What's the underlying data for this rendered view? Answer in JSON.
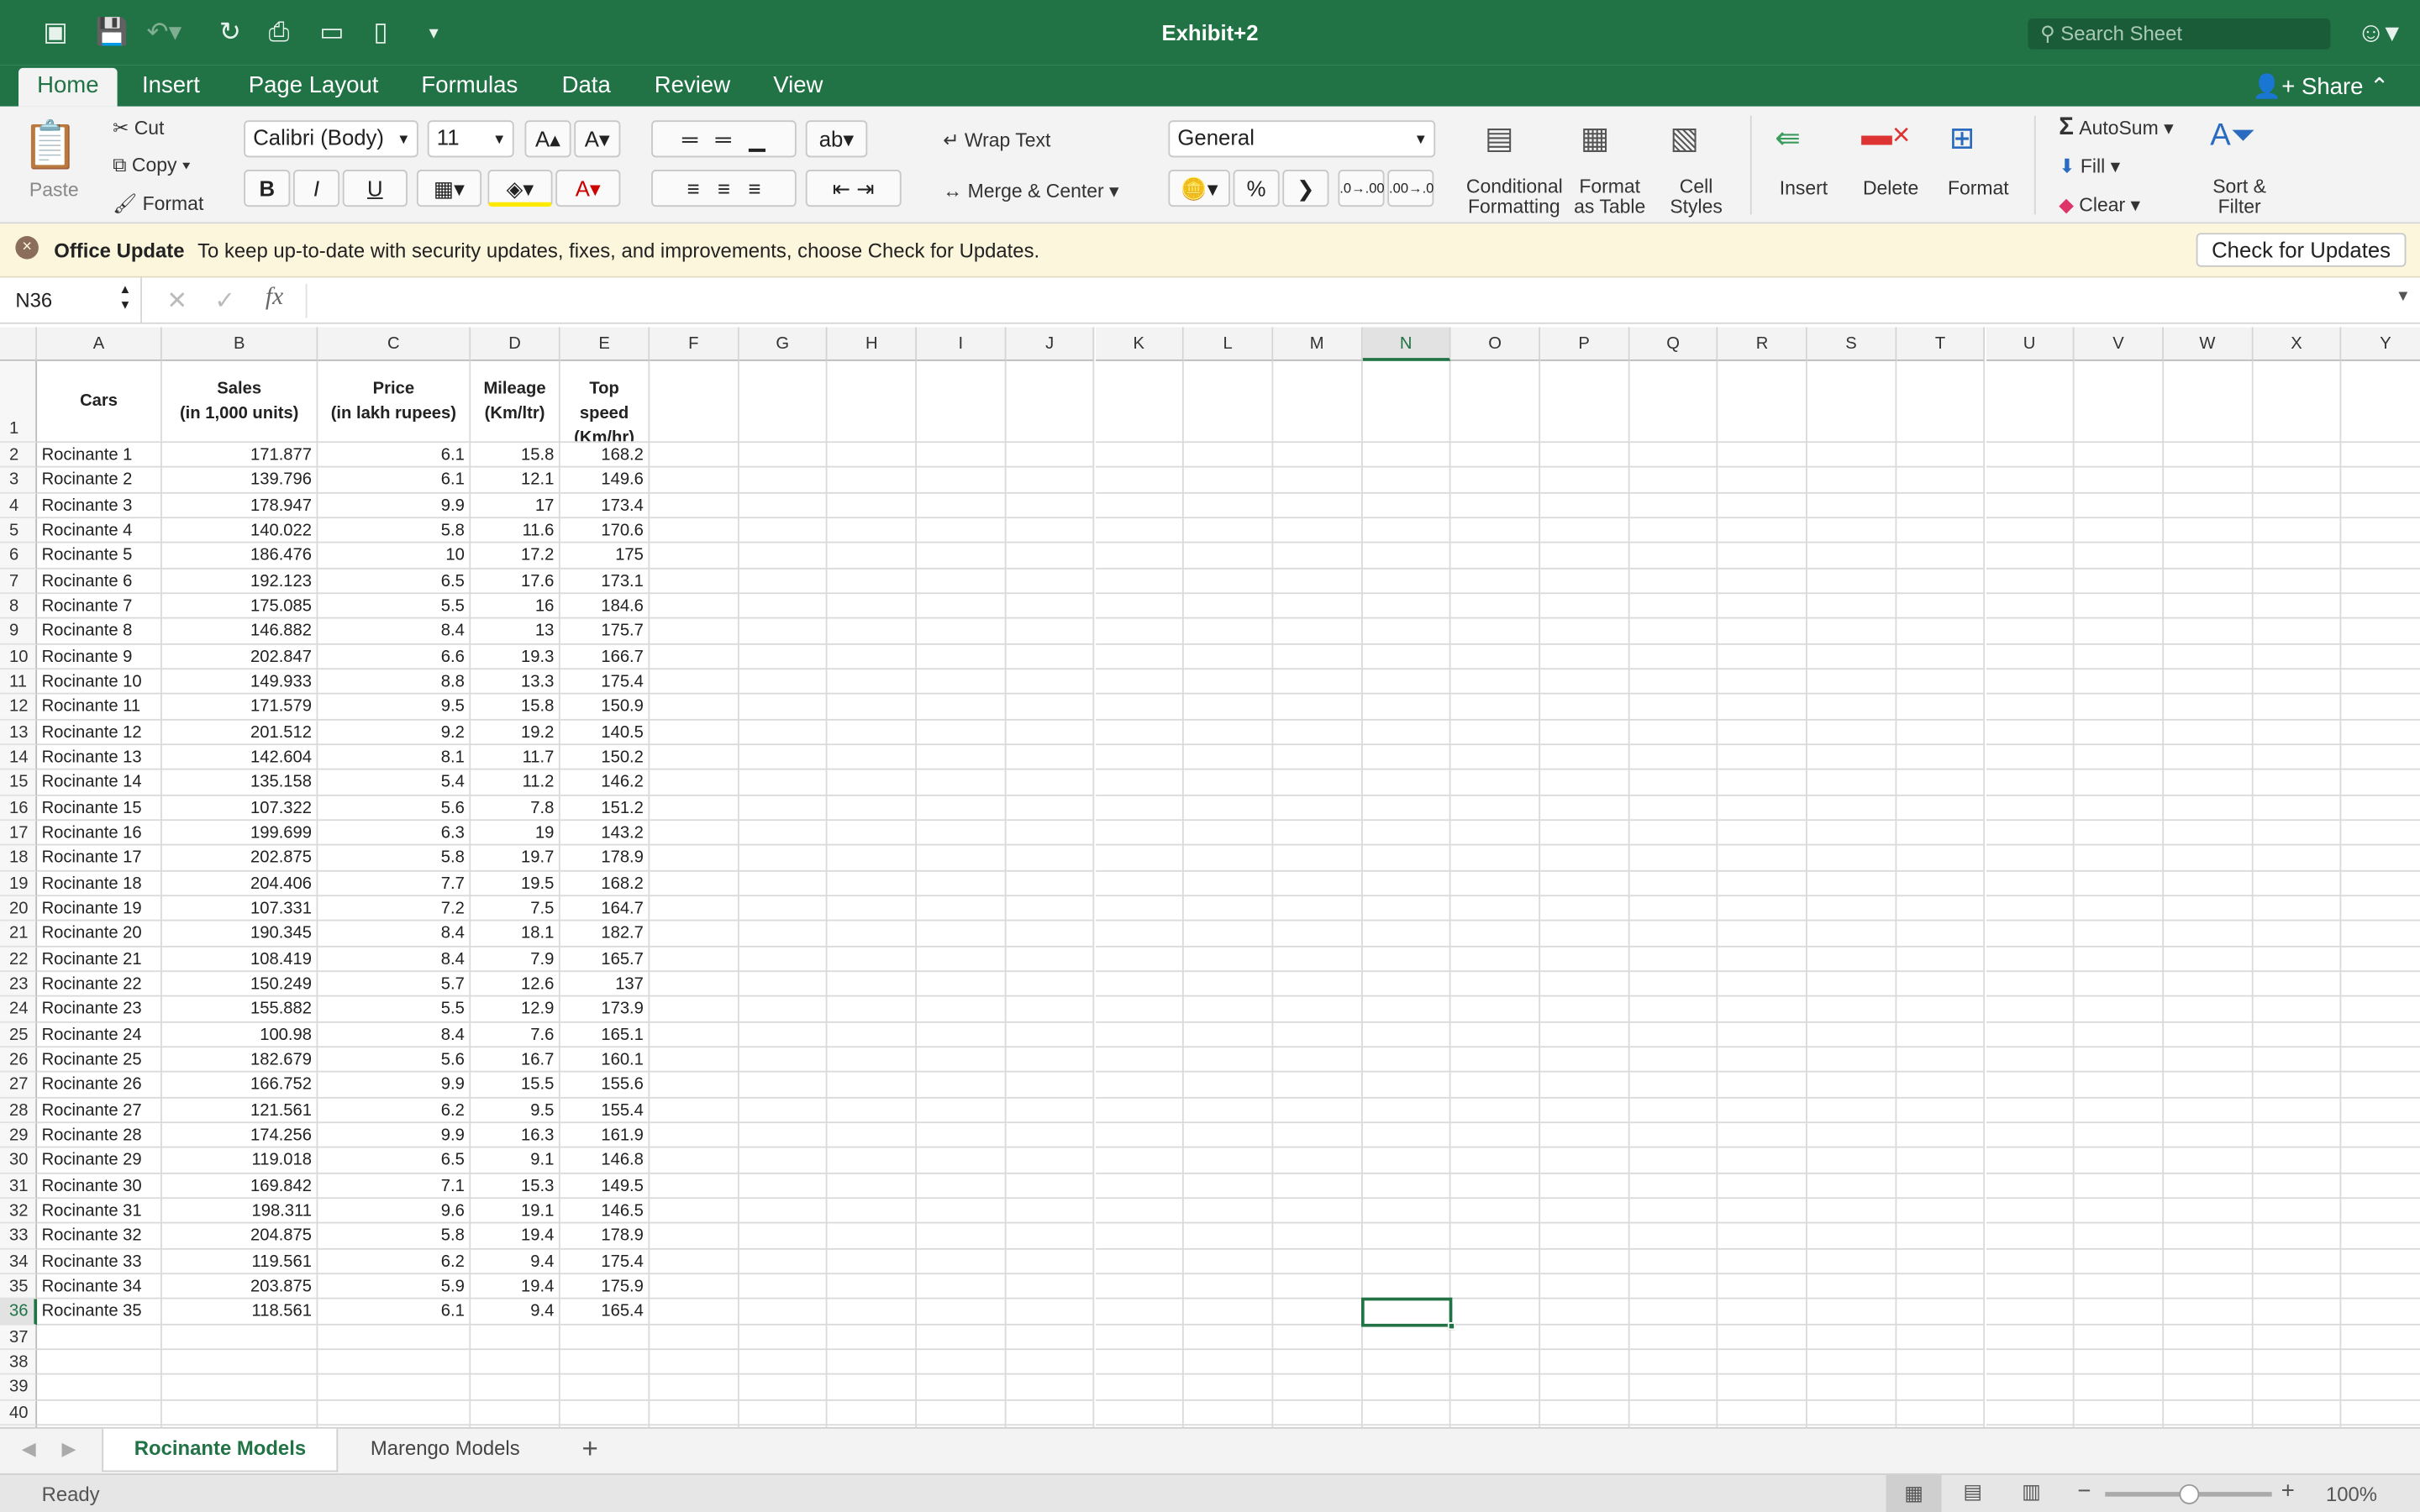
{
  "window": {
    "title": "Exhibit+2",
    "search_placeholder": "Search Sheet"
  },
  "colors": {
    "accent": "#217346",
    "selection": "#217346",
    "update_bar": "#fcf6dc"
  },
  "tabs": [
    {
      "label": "Home",
      "active": true
    },
    {
      "label": "Insert"
    },
    {
      "label": "Page Layout"
    },
    {
      "label": "Formulas"
    },
    {
      "label": "Data"
    },
    {
      "label": "Review"
    },
    {
      "label": "View"
    }
  ],
  "share_label": "Share",
  "ribbon": {
    "paste": "Paste",
    "cut": "Cut",
    "copy": "Copy",
    "format_painter": "Format",
    "font": "Calibri (Body)",
    "font_size": "11",
    "bold": "B",
    "italic": "I",
    "underline": "U",
    "wrap_text": "Wrap Text",
    "merge_center": "Merge & Center",
    "number_format": "General",
    "percent": "%",
    "comma": "❯",
    "conditional": "Conditional Formatting",
    "format_table": "Format as Table",
    "cell_styles": "Cell Styles",
    "insert": "Insert",
    "delete": "Delete",
    "format": "Format",
    "autosum": "AutoSum",
    "fill": "Fill",
    "clear": "Clear",
    "sort_filter": "Sort & Filter"
  },
  "update": {
    "title": "Office Update",
    "message": "To keep up-to-date with security updates, fixes, and improvements, choose Check for Updates.",
    "button": "Check for Updates"
  },
  "formula_bar": {
    "name_box": "N36",
    "fx": "fx",
    "value": ""
  },
  "columns": [
    "A",
    "B",
    "C",
    "D",
    "E",
    "F",
    "G",
    "H",
    "I",
    "J",
    "K",
    "L",
    "M",
    "N",
    "O",
    "P",
    "Q",
    "R",
    "S",
    "T",
    "U",
    "V",
    "W",
    "X",
    "Y"
  ],
  "selected_cell": "N36",
  "table": {
    "headers": [
      "Cars",
      "Sales\n(in 1,000 units)",
      "Price\n(in lakh rupees)",
      "Mileage\n(Km/ltr)",
      "Top speed\n(Km/hr)"
    ],
    "rows": [
      [
        "Rocinante 1",
        "171.877",
        "6.1",
        "15.8",
        "168.2"
      ],
      [
        "Rocinante 2",
        "139.796",
        "6.1",
        "12.1",
        "149.6"
      ],
      [
        "Rocinante 3",
        "178.947",
        "9.9",
        "17",
        "173.4"
      ],
      [
        "Rocinante 4",
        "140.022",
        "5.8",
        "11.6",
        "170.6"
      ],
      [
        "Rocinante 5",
        "186.476",
        "10",
        "17.2",
        "175"
      ],
      [
        "Rocinante 6",
        "192.123",
        "6.5",
        "17.6",
        "173.1"
      ],
      [
        "Rocinante 7",
        "175.085",
        "5.5",
        "16",
        "184.6"
      ],
      [
        "Rocinante 8",
        "146.882",
        "8.4",
        "13",
        "175.7"
      ],
      [
        "Rocinante 9",
        "202.847",
        "6.6",
        "19.3",
        "166.7"
      ],
      [
        "Rocinante 10",
        "149.933",
        "8.8",
        "13.3",
        "175.4"
      ],
      [
        "Rocinante 11",
        "171.579",
        "9.5",
        "15.8",
        "150.9"
      ],
      [
        "Rocinante 12",
        "201.512",
        "9.2",
        "19.2",
        "140.5"
      ],
      [
        "Rocinante 13",
        "142.604",
        "8.1",
        "11.7",
        "150.2"
      ],
      [
        "Rocinante 14",
        "135.158",
        "5.4",
        "11.2",
        "146.2"
      ],
      [
        "Rocinante 15",
        "107.322",
        "5.6",
        "7.8",
        "151.2"
      ],
      [
        "Rocinante 16",
        "199.699",
        "6.3",
        "19",
        "143.2"
      ],
      [
        "Rocinante 17",
        "202.875",
        "5.8",
        "19.7",
        "178.9"
      ],
      [
        "Rocinante 18",
        "204.406",
        "7.7",
        "19.5",
        "168.2"
      ],
      [
        "Rocinante 19",
        "107.331",
        "7.2",
        "7.5",
        "164.7"
      ],
      [
        "Rocinante 20",
        "190.345",
        "8.4",
        "18.1",
        "182.7"
      ],
      [
        "Rocinante 21",
        "108.419",
        "8.4",
        "7.9",
        "165.7"
      ],
      [
        "Rocinante 22",
        "150.249",
        "5.7",
        "12.6",
        "137"
      ],
      [
        "Rocinante 23",
        "155.882",
        "5.5",
        "12.9",
        "173.9"
      ],
      [
        "Rocinante 24",
        "100.98",
        "8.4",
        "7.6",
        "165.1"
      ],
      [
        "Rocinante 25",
        "182.679",
        "5.6",
        "16.7",
        "160.1"
      ],
      [
        "Rocinante 26",
        "166.752",
        "9.9",
        "15.5",
        "155.6"
      ],
      [
        "Rocinante 27",
        "121.561",
        "6.2",
        "9.5",
        "155.4"
      ],
      [
        "Rocinante 28",
        "174.256",
        "9.9",
        "16.3",
        "161.9"
      ],
      [
        "Rocinante 29",
        "119.018",
        "6.5",
        "9.1",
        "146.8"
      ],
      [
        "Rocinante 30",
        "169.842",
        "7.1",
        "15.3",
        "149.5"
      ],
      [
        "Rocinante 31",
        "198.311",
        "9.6",
        "19.1",
        "146.5"
      ],
      [
        "Rocinante 32",
        "204.875",
        "5.8",
        "19.4",
        "178.9"
      ],
      [
        "Rocinante 33",
        "119.561",
        "6.2",
        "9.4",
        "175.4"
      ],
      [
        "Rocinante 34",
        "203.875",
        "5.9",
        "19.4",
        "175.9"
      ],
      [
        "Rocinante 35",
        "118.561",
        "6.1",
        "9.4",
        "165.4"
      ]
    ]
  },
  "sheets": [
    {
      "label": "Rocinante Models",
      "active": true
    },
    {
      "label": "Marengo Models"
    }
  ],
  "status": {
    "text": "Ready",
    "zoom": "100%",
    "zoom_level": 100
  }
}
